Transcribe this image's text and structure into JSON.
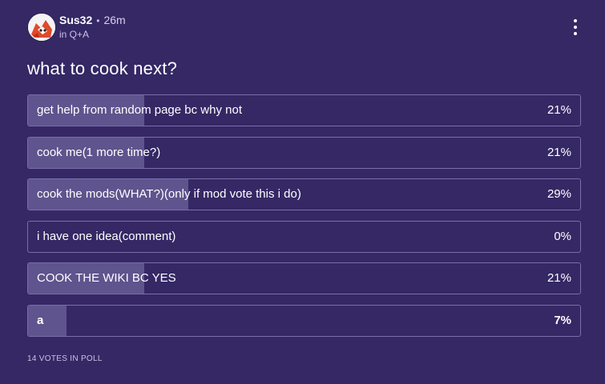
{
  "post": {
    "author": "Sus32",
    "time": "26m",
    "category": "in Q+A",
    "title": "what to cook next?"
  },
  "poll": {
    "options": [
      {
        "label": "get help from random page bc why not",
        "percent_text": "21%",
        "percent": 21,
        "bold": false
      },
      {
        "label": "cook me(1 more time?)",
        "percent_text": "21%",
        "percent": 21,
        "bold": false
      },
      {
        "label": "cook the mods(WHAT?)(only if mod vote this i do)",
        "percent_text": "29%",
        "percent": 29,
        "bold": false
      },
      {
        "label": "i have one idea(comment)",
        "percent_text": "0%",
        "percent": 0,
        "bold": false
      },
      {
        "label": "COOK THE WIKI BC YES",
        "percent_text": "21%",
        "percent": 21,
        "bold": false
      },
      {
        "label": "a",
        "percent_text": "7%",
        "percent": 7,
        "bold": true
      }
    ],
    "votes_text": "14 VOTES IN POLL"
  },
  "colors": {
    "background": "#352865",
    "bar_fill": "#5f548d",
    "border": "#7a6eaa"
  },
  "icons": {
    "avatar": "avatar-icon",
    "menu": "more-vertical-icon"
  }
}
